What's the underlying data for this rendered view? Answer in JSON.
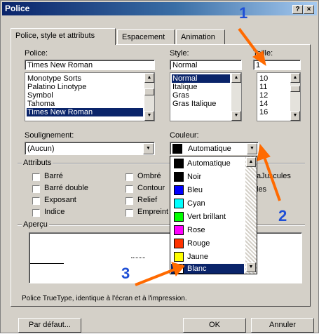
{
  "window": {
    "title": "Police",
    "help_btn": "?",
    "close_btn": "×"
  },
  "tabs": [
    {
      "label": "Police, style et attributs"
    },
    {
      "label": "Espacement"
    },
    {
      "label": "Animation"
    }
  ],
  "font": {
    "label": "Police:",
    "value": "Times New Roman",
    "items": [
      "Monotype Sorts",
      "Palatino Linotype",
      "Symbol",
      "Tahoma",
      "Times New Roman"
    ],
    "selected_index": 4
  },
  "style": {
    "label": "Style:",
    "value": "Normal",
    "items": [
      "Normal",
      "Italique",
      "Gras",
      "Gras Italique"
    ],
    "selected_index": 0
  },
  "size": {
    "label": "Taille:",
    "value": "1",
    "items": [
      "10",
      "11",
      "12",
      "14",
      "16"
    ]
  },
  "underline": {
    "label": "Soulignement:",
    "value": "(Aucun)"
  },
  "color": {
    "label": "Couleur:",
    "value": "Automatique",
    "options": [
      {
        "name": "Automatique",
        "swatch": "#000000"
      },
      {
        "name": "Noir",
        "swatch": "#000000"
      },
      {
        "name": "Bleu",
        "swatch": "#0000ff"
      },
      {
        "name": "Cyan",
        "swatch": "#00ffff"
      },
      {
        "name": "Vert brillant",
        "swatch": "#00ff00"
      },
      {
        "name": "Rose",
        "swatch": "#ff00ff"
      },
      {
        "name": "Rouge",
        "swatch": "#ff0000"
      },
      {
        "name": "Jaune",
        "swatch": "#ffff00"
      },
      {
        "name": "Blanc",
        "swatch": "#ffffff"
      }
    ],
    "highlighted_index": 8
  },
  "attributes": {
    "label": "Attributs",
    "col1": [
      "Barré",
      "Barré double",
      "Exposant",
      "Indice"
    ],
    "col2": [
      "Ombré",
      "Contour",
      "Relief",
      "Empreint"
    ],
    "col3_fragments": [
      "aJuscules",
      "les"
    ]
  },
  "preview": {
    "label": "Aperçu",
    "note": "Police TrueType, identique à l'écran et à l'impression."
  },
  "buttons": {
    "default": "Par défaut...",
    "ok": "OK",
    "cancel": "Annuler"
  },
  "annotations": {
    "arrow_color": "#ff6a00",
    "number_color": "#1f4fd6",
    "labels": [
      "1",
      "2",
      "3"
    ]
  }
}
